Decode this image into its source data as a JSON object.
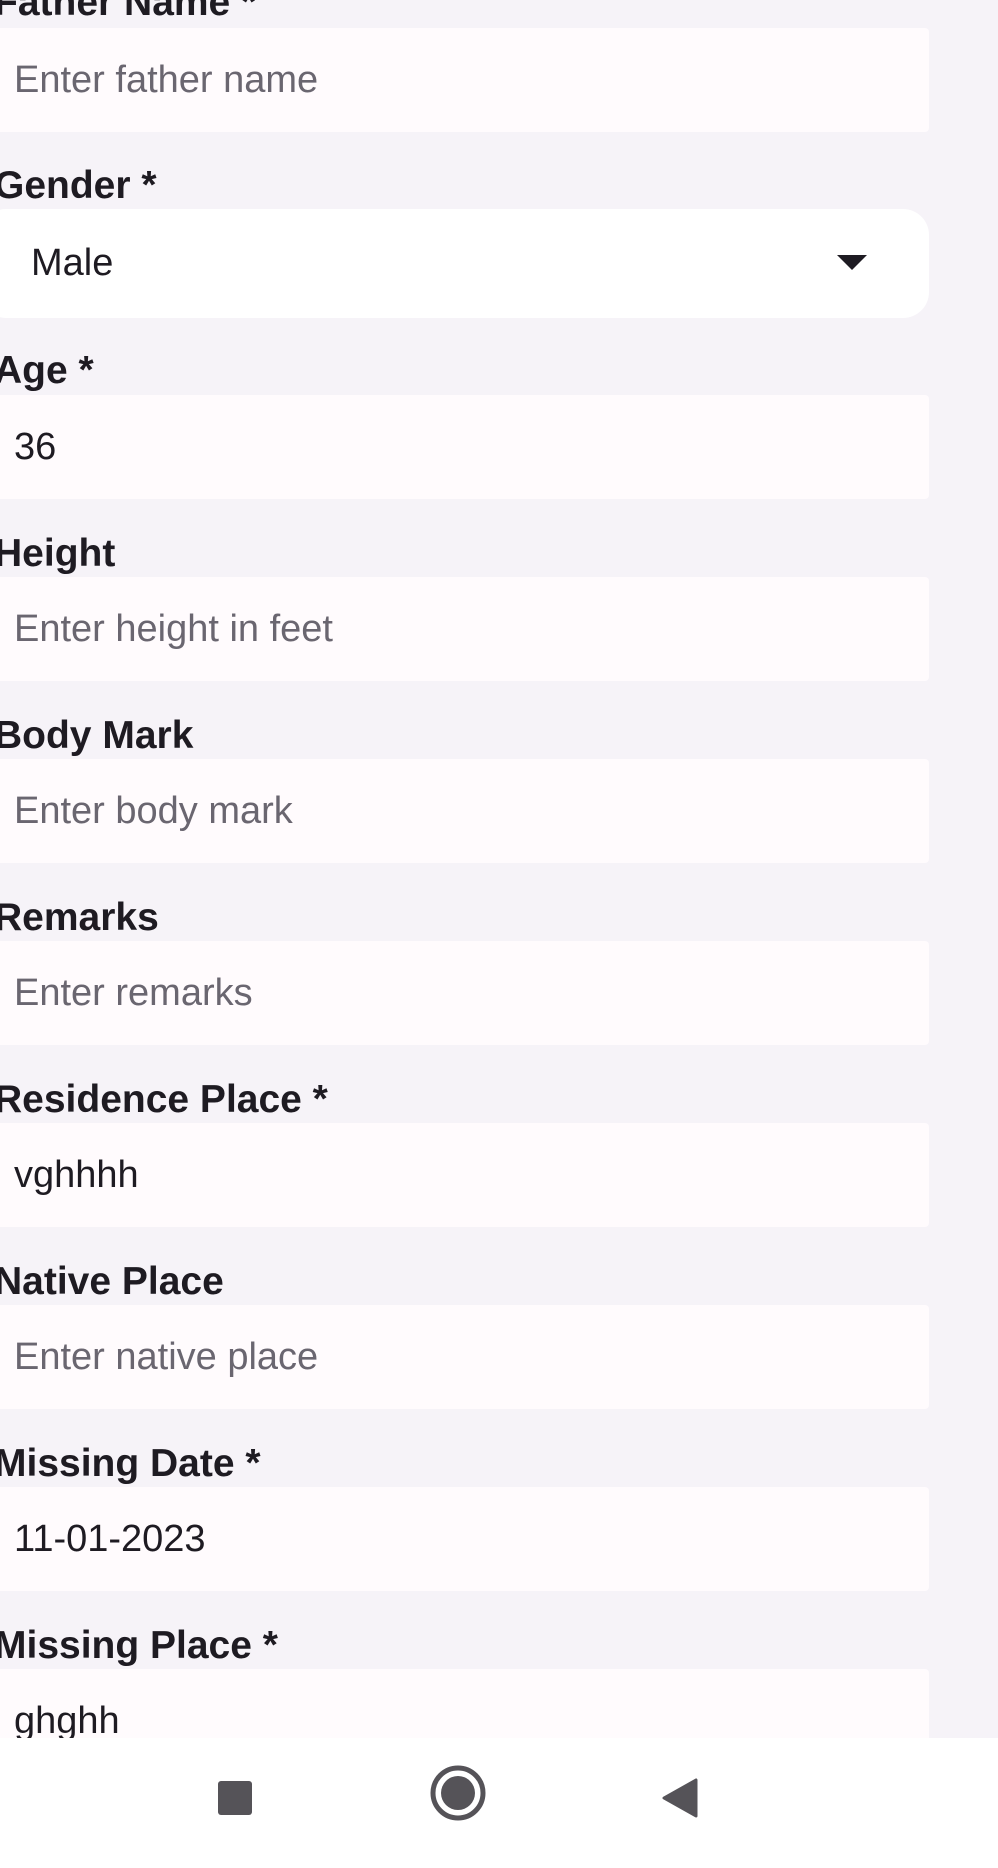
{
  "form": {
    "father_name": {
      "label": "Father Name *",
      "placeholder": "Enter father name",
      "value": ""
    },
    "gender": {
      "label": "Gender *",
      "value": "Male",
      "icon": "dropdown-arrow-icon"
    },
    "age": {
      "label": "Age *",
      "placeholder": "",
      "value": "36"
    },
    "height": {
      "label": "Height",
      "placeholder": "Enter height in feet",
      "value": ""
    },
    "body_mark": {
      "label": "Body Mark",
      "placeholder": "Enter body mark",
      "value": ""
    },
    "remarks": {
      "label": "Remarks",
      "placeholder": "Enter remarks",
      "value": ""
    },
    "residence_place": {
      "label": "Residence Place *",
      "placeholder": "",
      "value": "vghhhh"
    },
    "native_place": {
      "label": "Native Place",
      "placeholder": "Enter native place",
      "value": ""
    },
    "missing_date": {
      "label": "Missing Date *",
      "placeholder": "",
      "value": "11-01-2023"
    },
    "missing_place": {
      "label": "Missing Place *",
      "placeholder": "",
      "value": "ghghh"
    }
  },
  "nav_bar": {
    "recents_icon": "square-recents-icon",
    "home_icon": "circle-home-icon",
    "back_icon": "triangle-back-icon"
  },
  "colors": {
    "background": "#f6f3f8",
    "field_fill": "#fffbfd",
    "text": "#1e1b22",
    "placeholder": "#6a6670",
    "nav_icon": "#555358"
  }
}
